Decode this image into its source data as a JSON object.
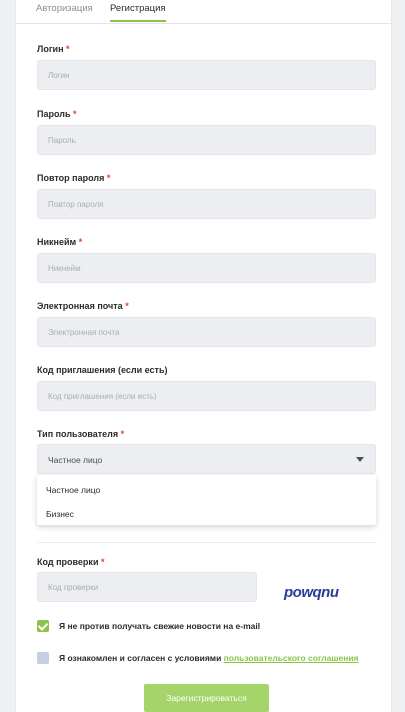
{
  "tabs": [
    {
      "label": "Авторизация",
      "active": false
    },
    {
      "label": "Регистрация",
      "active": true
    }
  ],
  "fields": {
    "login": {
      "label": "Логин",
      "required_mark": "*",
      "placeholder": "Логин"
    },
    "password": {
      "label": "Пароль",
      "required_mark": "*",
      "placeholder": "Пароль"
    },
    "password_repeat": {
      "label": "Повтор пароля",
      "required_mark": "*",
      "placeholder": "Повтор пароля"
    },
    "nickname": {
      "label": "Никнейм",
      "required_mark": "*",
      "placeholder": "Никнейм"
    },
    "email": {
      "label": "Электронная почта",
      "required_mark": "*",
      "placeholder": "Электронная почта"
    },
    "invite_code": {
      "label": "Код приглашения (если есть)",
      "placeholder": "Код приглашения (если есть)"
    },
    "user_type": {
      "label": "Тип пользователя",
      "required_mark": "*",
      "selected": "Частное лицо",
      "options": [
        "Частное лицо",
        "Бизнес"
      ]
    },
    "verification_code": {
      "label": "Код проверки",
      "required_mark": "*",
      "placeholder": "Код проверки"
    }
  },
  "captcha": {
    "text": "powqnu"
  },
  "checkboxes": {
    "newsletter": {
      "label": "Я не против получать свежие новости на e-mail",
      "checked": true
    },
    "terms": {
      "label_prefix": "Я ознакомлен и согласен с условиями ",
      "link_text": "пользовательского соглашения",
      "checked": false
    }
  },
  "submit": {
    "label": "Зарегистрироваться"
  },
  "colors": {
    "accent": "#8bc34a",
    "required": "#e53935",
    "input_bg": "#eceef1",
    "captcha": "#2a3d96"
  }
}
